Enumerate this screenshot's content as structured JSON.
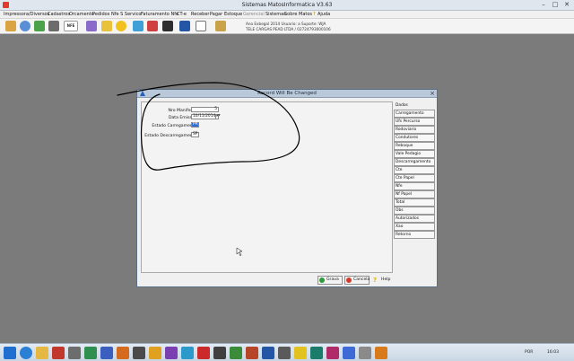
{
  "window": {
    "title": "Sistemas MatosInformatica V3.63"
  },
  "menu": [
    {
      "label": "Impressora/Diversos",
      "disabled": false
    },
    {
      "label": "Cadastros",
      "disabled": false
    },
    {
      "label": "Orcamento",
      "disabled": false
    },
    {
      "label": "Pedidos",
      "disabled": false
    },
    {
      "label": "Nfe S Servico",
      "disabled": false
    },
    {
      "label": "Faturamento Nfe",
      "disabled": false
    },
    {
      "label": "CT-e",
      "disabled": false
    },
    {
      "label": "Receber",
      "disabled": false
    },
    {
      "label": "Pagar",
      "disabled": false
    },
    {
      "label": "Estoque",
      "disabled": false
    },
    {
      "label": "Gerencial",
      "disabled": true
    },
    {
      "label": "Sistemas",
      "disabled": false
    },
    {
      "label": "Sobre Matos",
      "disabled": false
    },
    {
      "label": "Ajuda",
      "disabled": false
    }
  ],
  "toolbar": {
    "info_line1": "Ano Exbegal 2014  Usuario: a Suporte: WJA",
    "info_line2": "TELE CARGAS PEAD LTDA / 02724793000106",
    "nfe_badge": "NFE"
  },
  "dialog": {
    "title": "Record Will Be Changed",
    "fields": {
      "nro_manifesto_label": "Nro Manifesto:",
      "nro_manifesto_value": "5",
      "data_emissao_label": "Data Emissão:",
      "data_emissao_value": "10/11/2014",
      "estado_carregamento_label": "Estado Carregamento:",
      "estado_carregamento_value": "PR",
      "estado_descarregamento_label": "Estado Descarregamento:",
      "estado_descarregamento_value": "SP"
    },
    "tabs": [
      {
        "label": "Dados",
        "plain": true
      },
      {
        "label": "Carregamento",
        "plain": false
      },
      {
        "label": "Ufs Percurso",
        "plain": false
      },
      {
        "label": "Rodoviario",
        "plain": false
      },
      {
        "label": "Condutores",
        "plain": false
      },
      {
        "label": "Reboque",
        "plain": false
      },
      {
        "label": "Vale Pedagio",
        "plain": false
      },
      {
        "label": "Descarregamento",
        "plain": false
      },
      {
        "label": "Cte",
        "plain": false
      },
      {
        "label": "Cte Papel",
        "plain": false
      },
      {
        "label": "Nfe",
        "plain": false
      },
      {
        "label": "Nf Papel",
        "plain": false
      },
      {
        "label": "Total",
        "plain": false
      },
      {
        "label": "Obs",
        "plain": false
      },
      {
        "label": "Autorizados",
        "plain": false
      },
      {
        "label": "Xao",
        "plain": false
      },
      {
        "label": "Retorno",
        "plain": false
      }
    ],
    "buttons": {
      "ok": "Grava",
      "ok_sub": "Ok",
      "cancel": "Cancela",
      "help": "Help"
    }
  },
  "taskbar": {
    "clock": "16:03",
    "lang": "POR"
  },
  "colors": {
    "desktop": "#7b7b7b",
    "dialog_title": "#b9c9da",
    "selection": "#2f6ed6",
    "annotation": "#000000"
  }
}
